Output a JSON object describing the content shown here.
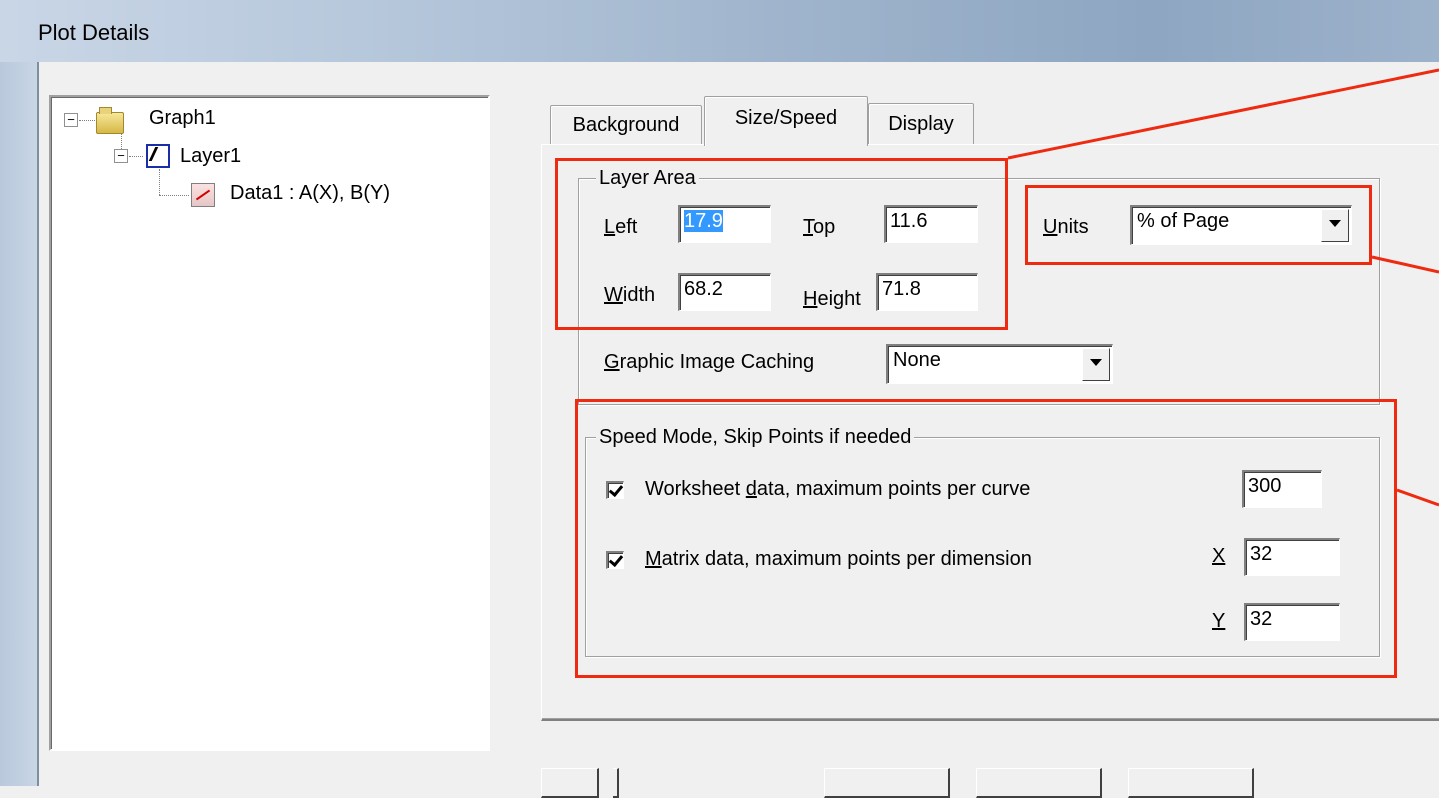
{
  "window": {
    "title": "Plot Details"
  },
  "tree": {
    "root": {
      "label": "Graph1",
      "icon": "folder-icon"
    },
    "layer": {
      "label": "Layer1",
      "icon": "layer-icon"
    },
    "data": {
      "label": "Data1 : A(X), B(Y)",
      "icon": "data-plot-icon"
    }
  },
  "tabs": [
    {
      "label": "Background",
      "active": false
    },
    {
      "label": "Size/Speed",
      "active": true
    },
    {
      "label": "Display",
      "active": false
    }
  ],
  "layer_area": {
    "title": "Layer Area",
    "left": {
      "mnemonic": "L",
      "rest": "eft",
      "value": "17.9",
      "selected": true
    },
    "top": {
      "mnemonic": "T",
      "rest": "op",
      "value": "11.6"
    },
    "width": {
      "mnemonic": "W",
      "rest": "idth",
      "value": "68.2"
    },
    "height": {
      "mnemonic": "H",
      "rest": "eight",
      "value": "71.8"
    }
  },
  "units": {
    "mnemonic": "U",
    "rest": "nits",
    "value": "% of Page"
  },
  "caching": {
    "mnemonic": "G",
    "rest": "raphic Image Caching",
    "value": "None"
  },
  "speed_mode": {
    "title": "Speed Mode, Skip Points if needed",
    "worksheet": {
      "pre": "Worksheet ",
      "mnemonic": "d",
      "post": "ata, maximum points per curve",
      "checked": true,
      "value": "300"
    },
    "matrix": {
      "pre": "",
      "mnemonic": "M",
      "post": "atrix data, maximum points per dimension",
      "checked": true
    },
    "x": {
      "label": "X",
      "value": "32"
    },
    "y": {
      "label": "Y",
      "value": "32"
    }
  },
  "colors": {
    "annotation": "#ee2a10",
    "selection": "#3399ff",
    "tree_layer_border": "#1a2ea8"
  }
}
